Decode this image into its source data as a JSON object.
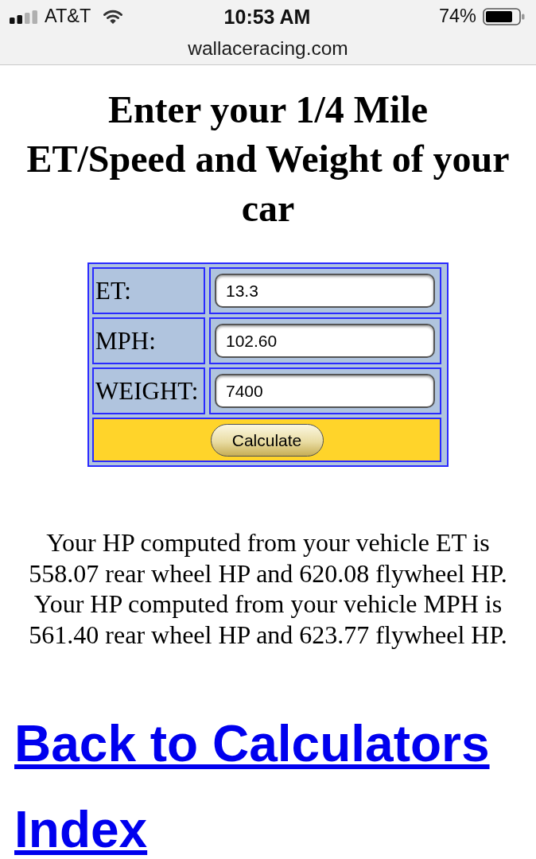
{
  "status_bar": {
    "carrier": "AT&T",
    "time": "10:53 AM",
    "battery": "74%"
  },
  "address_bar": {
    "url": "wallaceracing.com"
  },
  "heading": {
    "lines": [
      "Enter your 1/4 Mile",
      "ET/Speed and Weight of your car"
    ]
  },
  "form": {
    "fields": [
      {
        "label": "ET:",
        "value": "13.3"
      },
      {
        "label": "MPH:",
        "value": "102.60"
      },
      {
        "label": "WEIGHT:",
        "value": "7400"
      }
    ],
    "button": "Calculate"
  },
  "results": [
    "Your HP computed from your vehicle ET is 558.07 rear wheel HP and 620.08 flywheel HP.",
    "Your HP computed from your vehicle MPH is 561.40 rear wheel HP and 623.77 flywheel HP."
  ],
  "link": {
    "label": "Back to Calculators Index"
  }
}
